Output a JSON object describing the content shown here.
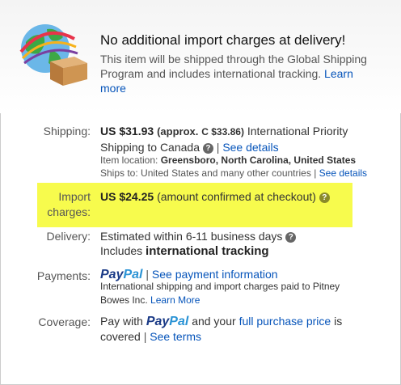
{
  "headline": "No additional import charges at delivery!",
  "note": {
    "text": "This item will be shipped through the Global Shipping Program and includes international tracking.",
    "link": "Learn more"
  },
  "shipping": {
    "label": "Shipping:",
    "price": "US $31.93",
    "approx_prefix": "(approx.",
    "approx_value": "C $33.86)",
    "service": "International Priority Shipping to Canada",
    "details_link": "See details",
    "location_label": "Item location:",
    "location_value": "Greensboro, North Carolina, United States",
    "ships_to_label": "Ships to:",
    "ships_to_value": "United States and many other countries",
    "ships_to_link": "See details"
  },
  "import": {
    "label_line1": "Import",
    "label_line2": "charges:",
    "price": "US $24.25",
    "note": "(amount confirmed at checkout)"
  },
  "delivery": {
    "label": "Delivery:",
    "estimate": "Estimated within 6-11 business days",
    "includes_prefix": "Includes",
    "includes_bold": "international tracking"
  },
  "payments": {
    "label": "Payments:",
    "paypal_pay": "Pay",
    "paypal_pal": "Pal",
    "link": "See payment information",
    "note": "International shipping and import charges paid to Pitney Bowes Inc.",
    "learn_more": "Learn More"
  },
  "coverage": {
    "label": "Coverage:",
    "prefix": "Pay with",
    "paypal_pay": "Pay",
    "paypal_pal": "Pal",
    "middle": "and your",
    "link": "full purchase price",
    "suffix": "is covered",
    "terms_link": "See terms"
  },
  "icons": {
    "help": "?",
    "separator": "|"
  },
  "colors": {
    "link": "#0654ba",
    "highlight": "#f7fb4d",
    "paypal_dark": "#1b3b87",
    "paypal_light": "#2a93d5"
  }
}
